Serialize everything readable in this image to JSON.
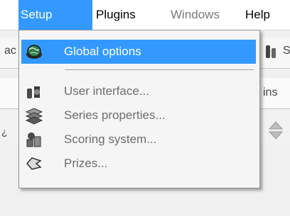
{
  "menubar": {
    "items": [
      {
        "label": "Setup"
      },
      {
        "label": "Plugins"
      },
      {
        "label": "Windows"
      },
      {
        "label": "Help"
      }
    ]
  },
  "background": {
    "frag_left_1": "ac",
    "frag_right_1": "S",
    "frag_right_2": "ins",
    "frag_left_3": "¿"
  },
  "dropdown": {
    "items": [
      {
        "label": "Global options",
        "icon": "globe-icon"
      },
      {
        "label": "User interface...",
        "icon": "user-interface-icon"
      },
      {
        "label": "Series properties...",
        "icon": "series-stack-icon"
      },
      {
        "label": "Scoring system...",
        "icon": "scoring-icon"
      },
      {
        "label": "Prizes...",
        "icon": "prizes-icon"
      }
    ]
  },
  "colors": {
    "highlight": "#3399ff",
    "disabled_text": "#6d6d6d"
  }
}
